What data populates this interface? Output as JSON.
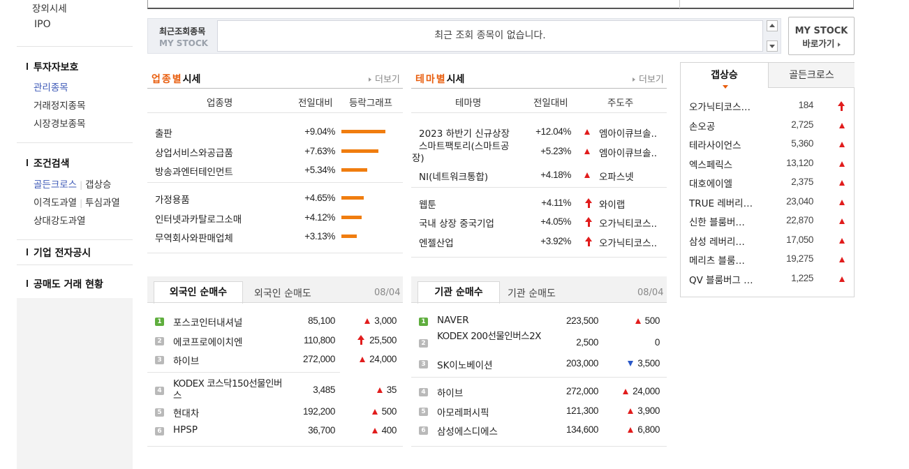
{
  "sidebar": {
    "top_links": [
      "장외시세",
      "IPO"
    ],
    "investor_protection": {
      "heading": "투자자보호",
      "links": [
        "관리종목",
        "거래정지종목",
        "시장경보종목"
      ]
    },
    "condition_search": {
      "heading": "조건검색",
      "row1": [
        "골든크로스",
        "갭상승"
      ],
      "row2": [
        "이격도과열",
        "투심과열"
      ],
      "row3": [
        "상대강도과열"
      ]
    },
    "disclosure_heading": "기업 전자공시",
    "short_selling_heading": "공매도 거래 현황"
  },
  "recent": {
    "label_kr": "최근조회종목",
    "label_en": "MY STOCK",
    "empty_message": "최근 조회 종목이 없습니다.",
    "mystock_line1": "MY STOCK",
    "mystock_line2": "바로가기"
  },
  "industry": {
    "title_accent": "업종별",
    "title_rest": "시세",
    "more": "더보기",
    "headers": [
      "업종명",
      "전일대비",
      "등락그래프"
    ],
    "rows": [
      {
        "name": "출판",
        "change": "+9.04%",
        "bar": 9.04
      },
      {
        "name": "상업서비스와공급품",
        "change": "+7.63%",
        "bar": 7.63
      },
      {
        "name": "방송과엔터테인먼트",
        "change": "+5.34%",
        "bar": 5.34
      },
      {
        "name": "가정용품",
        "change": "+4.65%",
        "bar": 4.65
      },
      {
        "name": "인터넷과카탈로그소매",
        "change": "+4.12%",
        "bar": 4.12
      },
      {
        "name": "무역회사와판매업체",
        "change": "+3.13%",
        "bar": 3.13
      }
    ]
  },
  "theme": {
    "title_accent": "테마별",
    "title_rest": "시세",
    "more": "더보기",
    "headers": [
      "테마명",
      "전일대비",
      "주도주"
    ],
    "rows": [
      {
        "name": "2023 하반기 신규상장",
        "change": "+12.04%",
        "arrow": "up",
        "leader": "엠아이큐브솔.."
      },
      {
        "name": "스마트팩토리(스마트공장)",
        "change": "+5.23%",
        "arrow": "up",
        "leader": "엠아이큐브솔.."
      },
      {
        "name": "NI(네트워크통합)",
        "change": "+4.18%",
        "arrow": "up",
        "leader": "오파스넷"
      },
      {
        "name": "웹툰",
        "change": "+4.11%",
        "arrow": "limit",
        "leader": "와이랩"
      },
      {
        "name": "국내 상장 중국기업",
        "change": "+4.05%",
        "arrow": "limit",
        "leader": "오가닉티코스.."
      },
      {
        "name": "엔젤산업",
        "change": "+3.92%",
        "arrow": "limit",
        "leader": "오가닉티코스.."
      }
    ]
  },
  "foreign": {
    "tab_active": "외국인 순매수",
    "tab_inactive": "외국인 순매도",
    "date": "08/04",
    "rows": [
      {
        "rank": "1",
        "name": "포스코인터내셔널",
        "price": "85,100",
        "arrow": "up",
        "change": "3,000"
      },
      {
        "rank": "2",
        "name": "에코프로에이치엔",
        "price": "110,800",
        "arrow": "limit",
        "change": "25,500"
      },
      {
        "rank": "3",
        "name": "하이브",
        "price": "272,000",
        "arrow": "up",
        "change": "24,000"
      },
      {
        "rank": "4",
        "name": "KODEX 코스닥150선물인버스",
        "price": "3,485",
        "arrow": "up",
        "change": "35"
      },
      {
        "rank": "5",
        "name": "현대차",
        "price": "192,200",
        "arrow": "up",
        "change": "500"
      },
      {
        "rank": "6",
        "name": "HPSP",
        "price": "36,700",
        "arrow": "up",
        "change": "400"
      }
    ]
  },
  "institution": {
    "tab_active": "기관 순매수",
    "tab_inactive": "기관 순매도",
    "date": "08/04",
    "rows": [
      {
        "rank": "1",
        "name": "NAVER",
        "price": "223,500",
        "arrow": "up",
        "change": "500"
      },
      {
        "rank": "2",
        "name": "KODEX 200선물인버스2X",
        "price": "2,500",
        "arrow": "none",
        "change": "0"
      },
      {
        "rank": "3",
        "name": "SK이노베이션",
        "price": "203,000",
        "arrow": "down",
        "change": "3,500"
      },
      {
        "rank": "4",
        "name": "하이브",
        "price": "272,000",
        "arrow": "up",
        "change": "24,000"
      },
      {
        "rank": "5",
        "name": "아모레퍼시픽",
        "price": "121,300",
        "arrow": "up",
        "change": "3,900"
      },
      {
        "rank": "6",
        "name": "삼성에스디에스",
        "price": "134,600",
        "arrow": "up",
        "change": "6,800"
      }
    ]
  },
  "gap": {
    "tab_active": "갭상승",
    "tab_inactive": "골든크로스",
    "rows": [
      {
        "name": "오가닉티코스…",
        "price": "184",
        "arrow": "limit"
      },
      {
        "name": "손오공",
        "price": "2,725",
        "arrow": "up"
      },
      {
        "name": "테라사이언스",
        "price": "5,360",
        "arrow": "up"
      },
      {
        "name": "엑스페릭스",
        "price": "13,120",
        "arrow": "up"
      },
      {
        "name": "대호에이엘",
        "price": "2,375",
        "arrow": "up"
      },
      {
        "name": "TRUE 레버리…",
        "price": "23,040",
        "arrow": "up"
      },
      {
        "name": "신한 블룸버…",
        "price": "22,870",
        "arrow": "up"
      },
      {
        "name": "삼성 레버리…",
        "price": "17,050",
        "arrow": "up"
      },
      {
        "name": "메리츠 블룸…",
        "price": "19,275",
        "arrow": "up"
      },
      {
        "name": "QV 블룸버그 …",
        "price": "1,225",
        "arrow": "up"
      }
    ]
  },
  "colors": {
    "up": "#e11c1c",
    "down": "#2a58c8",
    "accent": "#e85d0d",
    "bar": "#f07d0f",
    "link": "#3e5ab7"
  }
}
